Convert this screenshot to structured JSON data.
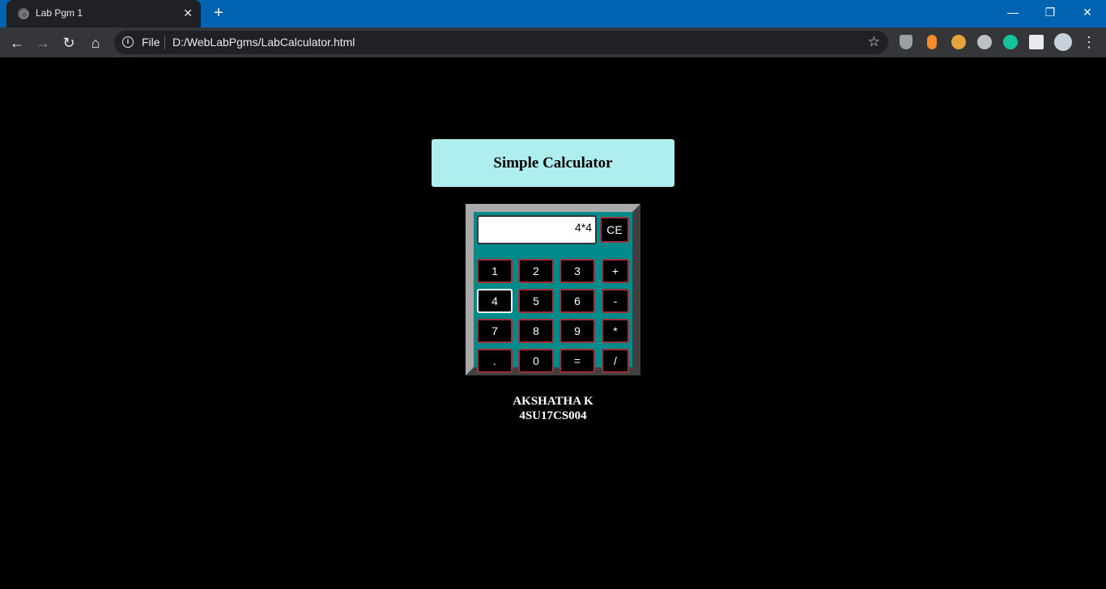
{
  "browser": {
    "tab_title": "Lab Pgm 1",
    "tab_close": "✕",
    "new_tab": "+",
    "window_minimize": "—",
    "window_restore": "❐",
    "window_close": "✕",
    "back": "←",
    "forward": "→",
    "reload": "↻",
    "home": "⌂",
    "info": "i",
    "scheme_label": "File",
    "url": "D:/WebLabPgms/LabCalculator.html",
    "bookmark_star": "☆",
    "menu": "⋮",
    "extensions": [
      {
        "name": "shield-icon",
        "color": "#9aa0a6"
      },
      {
        "name": "capsule-icon",
        "color": "#f28b30"
      },
      {
        "name": "glasses-icon",
        "color": "#e6a23c"
      },
      {
        "name": "bulb-icon",
        "color": "#bdc1c6"
      },
      {
        "name": "grammarly-icon",
        "color": "#15c39a"
      },
      {
        "name": "puzzle-icon",
        "color": "#e8eaed"
      },
      {
        "name": "profile-avatar",
        "color": "#c7d2dc"
      }
    ]
  },
  "page": {
    "heading": "Simple Calculator",
    "display_value": "4*4",
    "clear_label": "CE",
    "keys": [
      [
        "1",
        "2",
        "3",
        "+"
      ],
      [
        "4",
        "5",
        "6",
        "-"
      ],
      [
        "7",
        "8",
        "9",
        "*"
      ],
      [
        ".",
        "0",
        "=",
        "/"
      ]
    ],
    "focused_key": "4",
    "author_name": "AKSHATHA K",
    "author_usn": "4SU17CS004"
  },
  "colors": {
    "chrome_titlebar": "#0063b1",
    "heading_bg": "#afeeee",
    "calc_bg": "#008b8b",
    "key_border": "#a0313a"
  }
}
